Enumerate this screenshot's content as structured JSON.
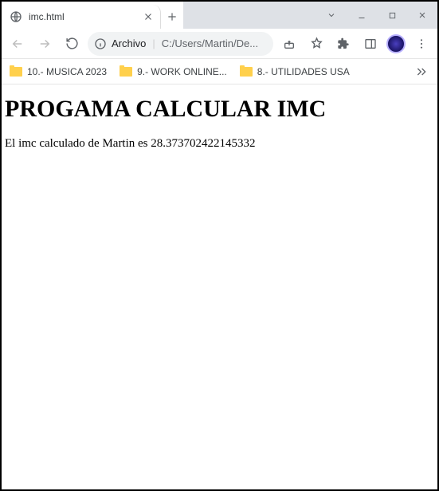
{
  "tab": {
    "title": "imc.html"
  },
  "omnibox": {
    "protocol": "Archivo",
    "path": "C:/Users/Martin/De..."
  },
  "bookmarks": {
    "items": [
      {
        "label": "10.- MUSICA 2023"
      },
      {
        "label": "9.- WORK ONLINE..."
      },
      {
        "label": "8.- UTILIDADES USA"
      }
    ]
  },
  "page": {
    "heading": "PROGAMA CALCULAR IMC",
    "result": "El imc calculado de Martin es 28.373702422145332"
  }
}
